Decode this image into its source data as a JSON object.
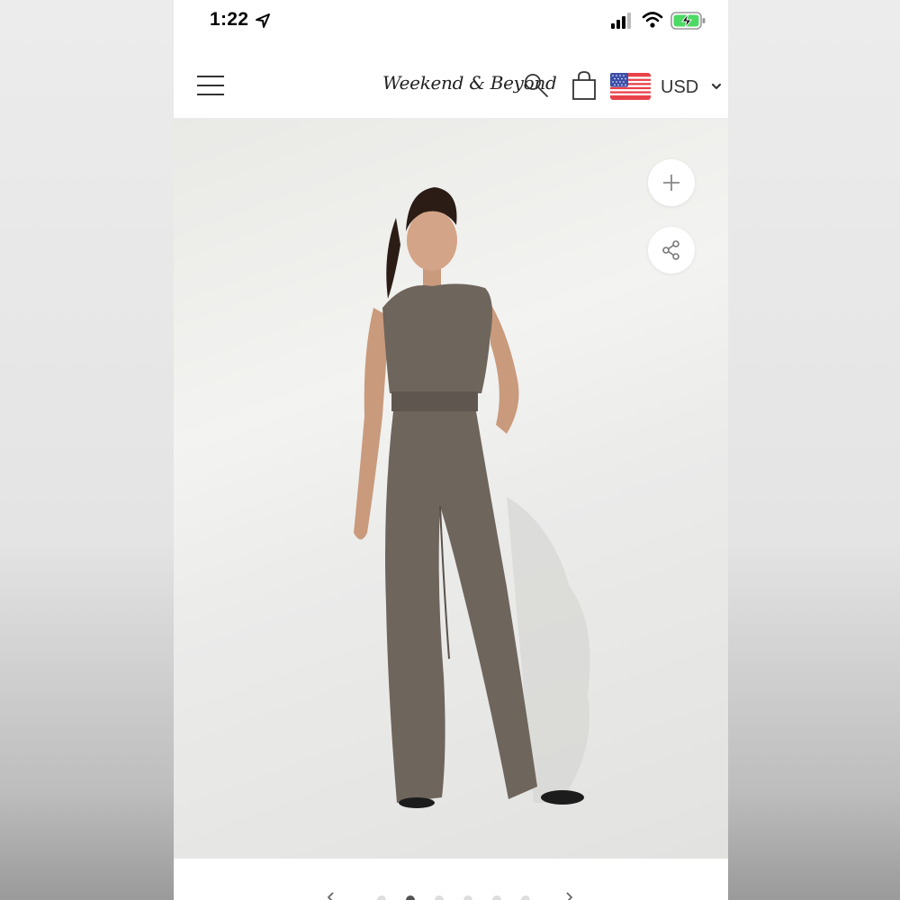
{
  "status_bar": {
    "time": "1:22",
    "icons": [
      "location-arrow-icon",
      "cellular-signal-icon",
      "wifi-icon",
      "battery-charging-icon"
    ],
    "battery_color": "#4cd964"
  },
  "header": {
    "brand": "Weekend & Beyond",
    "currency": "USD",
    "icons": [
      "hamburger-menu-icon",
      "search-icon",
      "shopping-bag-icon",
      "us-flag-icon",
      "chevron-down-icon"
    ]
  },
  "product": {
    "image": "model-wearing-grey-sleeveless-top-and-wide-leg-trousers",
    "actions": [
      "plus-icon",
      "share-icon"
    ]
  },
  "carousel": {
    "dots": 6,
    "active_dot": 2
  },
  "colors": {
    "outfit": "#6e655c",
    "background": "#ececec",
    "header_text": "#333333"
  }
}
